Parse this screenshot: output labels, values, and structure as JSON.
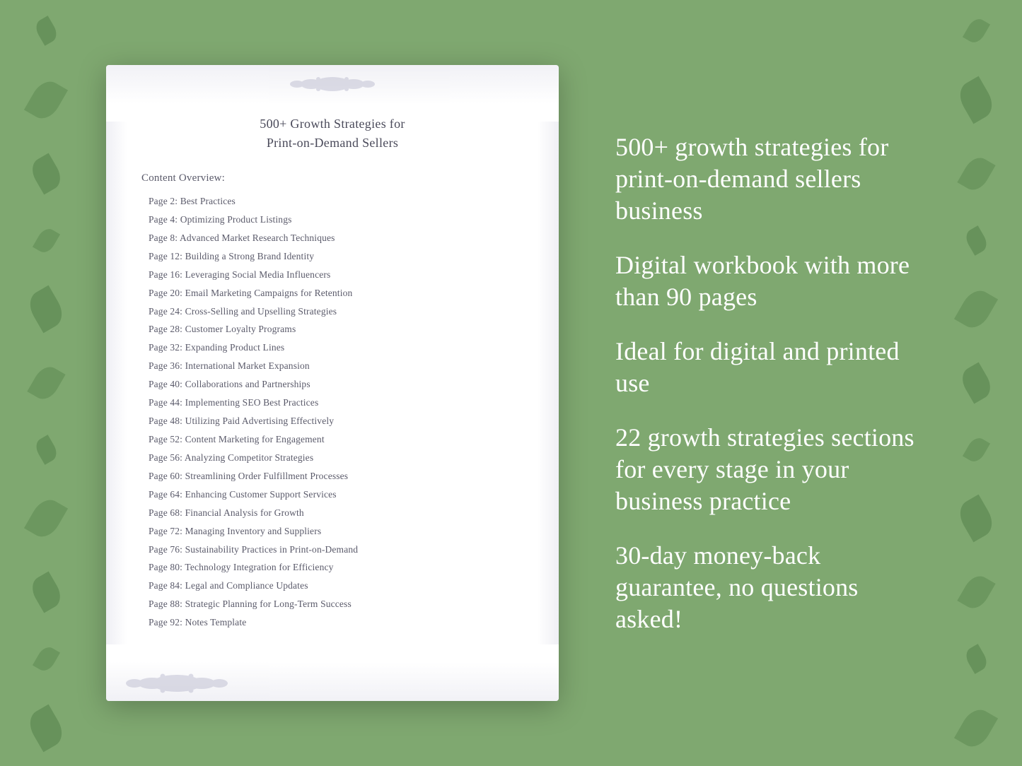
{
  "background": {
    "color": "#7fa870"
  },
  "document": {
    "title_line1": "500+ Growth Strategies for",
    "title_line2": "Print-on-Demand Sellers",
    "content_overview_label": "Content Overview:",
    "toc_items": [
      {
        "page": "Page  2:",
        "title": "Best Practices"
      },
      {
        "page": "Page  4:",
        "title": "Optimizing Product Listings"
      },
      {
        "page": "Page  8:",
        "title": "Advanced Market Research Techniques"
      },
      {
        "page": "Page 12:",
        "title": "Building a Strong Brand Identity"
      },
      {
        "page": "Page 16:",
        "title": "Leveraging Social Media Influencers"
      },
      {
        "page": "Page 20:",
        "title": "Email Marketing Campaigns for Retention"
      },
      {
        "page": "Page 24:",
        "title": "Cross-Selling and Upselling Strategies"
      },
      {
        "page": "Page 28:",
        "title": "Customer Loyalty Programs"
      },
      {
        "page": "Page 32:",
        "title": "Expanding Product Lines"
      },
      {
        "page": "Page 36:",
        "title": "International Market Expansion"
      },
      {
        "page": "Page 40:",
        "title": "Collaborations and Partnerships"
      },
      {
        "page": "Page 44:",
        "title": "Implementing SEO Best Practices"
      },
      {
        "page": "Page 48:",
        "title": "Utilizing Paid Advertising Effectively"
      },
      {
        "page": "Page 52:",
        "title": "Content Marketing for Engagement"
      },
      {
        "page": "Page 56:",
        "title": "Analyzing Competitor Strategies"
      },
      {
        "page": "Page 60:",
        "title": "Streamlining Order Fulfillment Processes"
      },
      {
        "page": "Page 64:",
        "title": "Enhancing Customer Support Services"
      },
      {
        "page": "Page 68:",
        "title": "Financial Analysis for Growth"
      },
      {
        "page": "Page 72:",
        "title": "Managing Inventory and Suppliers"
      },
      {
        "page": "Page 76:",
        "title": "Sustainability Practices in Print-on-Demand"
      },
      {
        "page": "Page 80:",
        "title": "Technology Integration for Efficiency"
      },
      {
        "page": "Page 84:",
        "title": "Legal and Compliance Updates"
      },
      {
        "page": "Page 88:",
        "title": "Strategic Planning for Long-Term Success"
      },
      {
        "page": "Page 92:",
        "title": "Notes Template"
      }
    ]
  },
  "features": [
    "500+ growth strategies for print-on-demand sellers business",
    "Digital workbook with more than 90 pages",
    "Ideal for digital and printed use",
    "22 growth strategies sections for every stage in your business practice",
    "30-day money-back guarantee, no questions asked!"
  ]
}
